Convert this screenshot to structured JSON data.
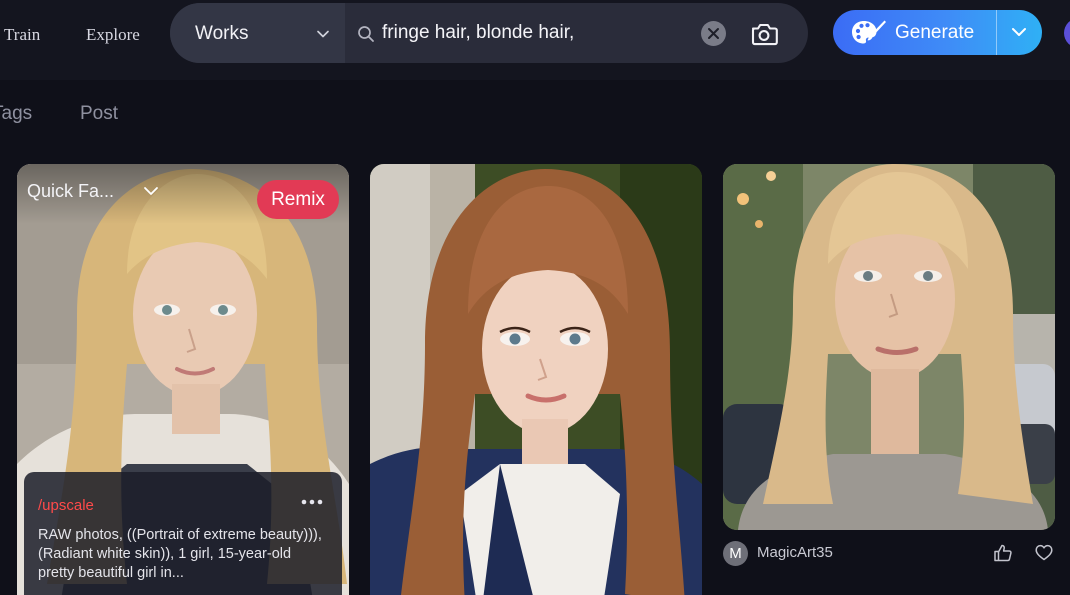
{
  "nav": {
    "train": "Train",
    "explore": "Explore"
  },
  "search": {
    "scope": "Works",
    "query": "fringe hair, blonde hair,"
  },
  "generate": {
    "label": "Generate"
  },
  "tabs": [
    {
      "label": "Tags"
    },
    {
      "label": "Post"
    }
  ],
  "cards": [
    {
      "model": "Quick Fa...",
      "remix_label": "Remix",
      "prompt_command": "/upscale",
      "prompt_text": "RAW photos, ((Portrait of extreme beauty))), (Radiant white skin)), 1 girl, 15-year-old pretty beautiful girl in..."
    },
    {},
    {
      "author_initial": "M",
      "author_name": "MagicArt35"
    }
  ],
  "colors": {
    "background": "#0f1019",
    "topbar": "#14151f",
    "accent_remix": "#e23a55",
    "accent_generate": "#3b6cf5",
    "prompt_command": "#ff4a4a"
  },
  "icons": {
    "search": "search-icon",
    "clear": "close-circle-icon",
    "camera": "camera-icon",
    "palette": "palette-brush-icon",
    "dropdown": "chevron-down-icon",
    "more": "more-dots-icon",
    "like": "thumbs-up-icon",
    "favorite": "heart-icon"
  }
}
